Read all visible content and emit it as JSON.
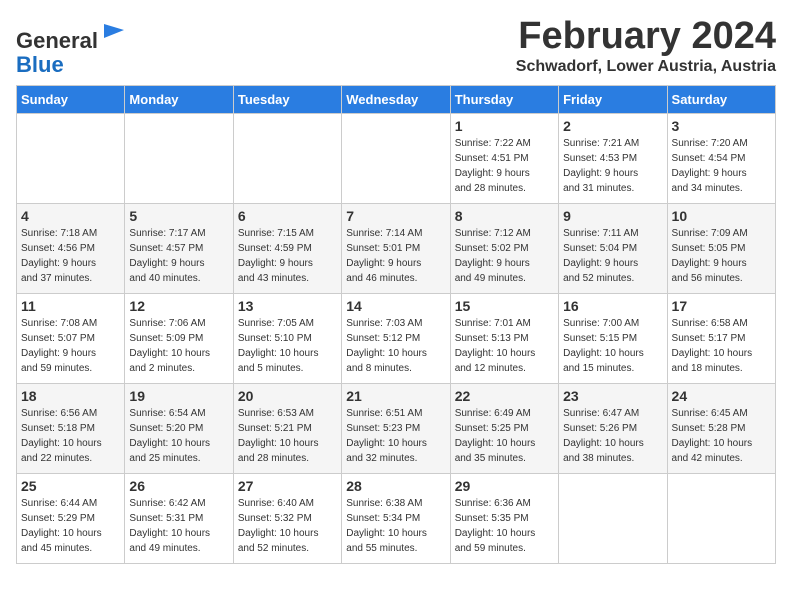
{
  "header": {
    "logo_general": "General",
    "logo_blue": "Blue",
    "month_title": "February 2024",
    "location": "Schwadorf, Lower Austria, Austria"
  },
  "weekdays": [
    "Sunday",
    "Monday",
    "Tuesday",
    "Wednesday",
    "Thursday",
    "Friday",
    "Saturday"
  ],
  "weeks": [
    [
      {
        "day": "",
        "info": ""
      },
      {
        "day": "",
        "info": ""
      },
      {
        "day": "",
        "info": ""
      },
      {
        "day": "",
        "info": ""
      },
      {
        "day": "1",
        "info": "Sunrise: 7:22 AM\nSunset: 4:51 PM\nDaylight: 9 hours\nand 28 minutes."
      },
      {
        "day": "2",
        "info": "Sunrise: 7:21 AM\nSunset: 4:53 PM\nDaylight: 9 hours\nand 31 minutes."
      },
      {
        "day": "3",
        "info": "Sunrise: 7:20 AM\nSunset: 4:54 PM\nDaylight: 9 hours\nand 34 minutes."
      }
    ],
    [
      {
        "day": "4",
        "info": "Sunrise: 7:18 AM\nSunset: 4:56 PM\nDaylight: 9 hours\nand 37 minutes."
      },
      {
        "day": "5",
        "info": "Sunrise: 7:17 AM\nSunset: 4:57 PM\nDaylight: 9 hours\nand 40 minutes."
      },
      {
        "day": "6",
        "info": "Sunrise: 7:15 AM\nSunset: 4:59 PM\nDaylight: 9 hours\nand 43 minutes."
      },
      {
        "day": "7",
        "info": "Sunrise: 7:14 AM\nSunset: 5:01 PM\nDaylight: 9 hours\nand 46 minutes."
      },
      {
        "day": "8",
        "info": "Sunrise: 7:12 AM\nSunset: 5:02 PM\nDaylight: 9 hours\nand 49 minutes."
      },
      {
        "day": "9",
        "info": "Sunrise: 7:11 AM\nSunset: 5:04 PM\nDaylight: 9 hours\nand 52 minutes."
      },
      {
        "day": "10",
        "info": "Sunrise: 7:09 AM\nSunset: 5:05 PM\nDaylight: 9 hours\nand 56 minutes."
      }
    ],
    [
      {
        "day": "11",
        "info": "Sunrise: 7:08 AM\nSunset: 5:07 PM\nDaylight: 9 hours\nand 59 minutes."
      },
      {
        "day": "12",
        "info": "Sunrise: 7:06 AM\nSunset: 5:09 PM\nDaylight: 10 hours\nand 2 minutes."
      },
      {
        "day": "13",
        "info": "Sunrise: 7:05 AM\nSunset: 5:10 PM\nDaylight: 10 hours\nand 5 minutes."
      },
      {
        "day": "14",
        "info": "Sunrise: 7:03 AM\nSunset: 5:12 PM\nDaylight: 10 hours\nand 8 minutes."
      },
      {
        "day": "15",
        "info": "Sunrise: 7:01 AM\nSunset: 5:13 PM\nDaylight: 10 hours\nand 12 minutes."
      },
      {
        "day": "16",
        "info": "Sunrise: 7:00 AM\nSunset: 5:15 PM\nDaylight: 10 hours\nand 15 minutes."
      },
      {
        "day": "17",
        "info": "Sunrise: 6:58 AM\nSunset: 5:17 PM\nDaylight: 10 hours\nand 18 minutes."
      }
    ],
    [
      {
        "day": "18",
        "info": "Sunrise: 6:56 AM\nSunset: 5:18 PM\nDaylight: 10 hours\nand 22 minutes."
      },
      {
        "day": "19",
        "info": "Sunrise: 6:54 AM\nSunset: 5:20 PM\nDaylight: 10 hours\nand 25 minutes."
      },
      {
        "day": "20",
        "info": "Sunrise: 6:53 AM\nSunset: 5:21 PM\nDaylight: 10 hours\nand 28 minutes."
      },
      {
        "day": "21",
        "info": "Sunrise: 6:51 AM\nSunset: 5:23 PM\nDaylight: 10 hours\nand 32 minutes."
      },
      {
        "day": "22",
        "info": "Sunrise: 6:49 AM\nSunset: 5:25 PM\nDaylight: 10 hours\nand 35 minutes."
      },
      {
        "day": "23",
        "info": "Sunrise: 6:47 AM\nSunset: 5:26 PM\nDaylight: 10 hours\nand 38 minutes."
      },
      {
        "day": "24",
        "info": "Sunrise: 6:45 AM\nSunset: 5:28 PM\nDaylight: 10 hours\nand 42 minutes."
      }
    ],
    [
      {
        "day": "25",
        "info": "Sunrise: 6:44 AM\nSunset: 5:29 PM\nDaylight: 10 hours\nand 45 minutes."
      },
      {
        "day": "26",
        "info": "Sunrise: 6:42 AM\nSunset: 5:31 PM\nDaylight: 10 hours\nand 49 minutes."
      },
      {
        "day": "27",
        "info": "Sunrise: 6:40 AM\nSunset: 5:32 PM\nDaylight: 10 hours\nand 52 minutes."
      },
      {
        "day": "28",
        "info": "Sunrise: 6:38 AM\nSunset: 5:34 PM\nDaylight: 10 hours\nand 55 minutes."
      },
      {
        "day": "29",
        "info": "Sunrise: 6:36 AM\nSunset: 5:35 PM\nDaylight: 10 hours\nand 59 minutes."
      },
      {
        "day": "",
        "info": ""
      },
      {
        "day": "",
        "info": ""
      }
    ]
  ]
}
